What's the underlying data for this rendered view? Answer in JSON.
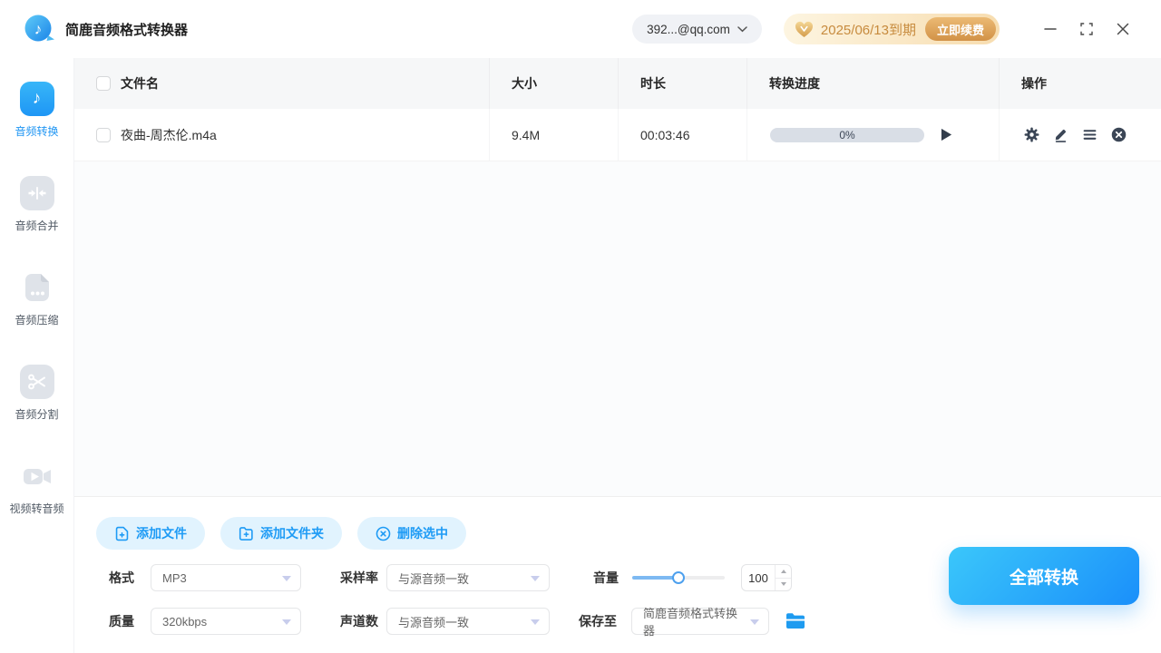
{
  "app_title": "简鹿音频格式转换器",
  "topbar": {
    "account": {
      "email": "392...@qq.com"
    },
    "vip": {
      "expiry": "2025/06/13到期",
      "renew_label": "立即续费"
    }
  },
  "sidebar": {
    "items": [
      {
        "label": "音频转换",
        "active": true
      },
      {
        "label": "音频合并",
        "active": false
      },
      {
        "label": "音频压缩",
        "active": false
      },
      {
        "label": "音频分割",
        "active": false
      },
      {
        "label": "视频转音频",
        "active": false
      }
    ]
  },
  "table": {
    "headers": [
      "文件名",
      "大小",
      "时长",
      "转换进度",
      "操作"
    ],
    "rows": [
      {
        "name": "夜曲-周杰伦.m4a",
        "size": "9.4M",
        "duration": "00:03:46",
        "progress_label": "0%",
        "progress_percent": 0
      }
    ]
  },
  "actions": {
    "add_file": "添加文件",
    "add_folder": "添加文件夹",
    "delete_selected": "删除选中",
    "convert_all": "全部转换"
  },
  "settings": {
    "format": {
      "label": "格式",
      "value": "MP3"
    },
    "sample_rate": {
      "label": "采样率",
      "value": "与源音频一致"
    },
    "volume": {
      "label": "音量",
      "value": "100"
    },
    "quality": {
      "label": "质量",
      "value": "320kbps"
    },
    "channels": {
      "label": "声道数",
      "value": "与源音频一致"
    },
    "save_to": {
      "label": "保存至",
      "value": "简鹿音频格式转换器"
    }
  },
  "colors": {
    "accent": "#1e9bf5",
    "accent_light_bg": "#e1f3fe",
    "convert_gradient": [
      "#3bc7fa",
      "#1a8ffa"
    ],
    "vip_text": "#c78b3e",
    "icon_slate": "#3b4656",
    "progress_track": "#d9dee6"
  }
}
